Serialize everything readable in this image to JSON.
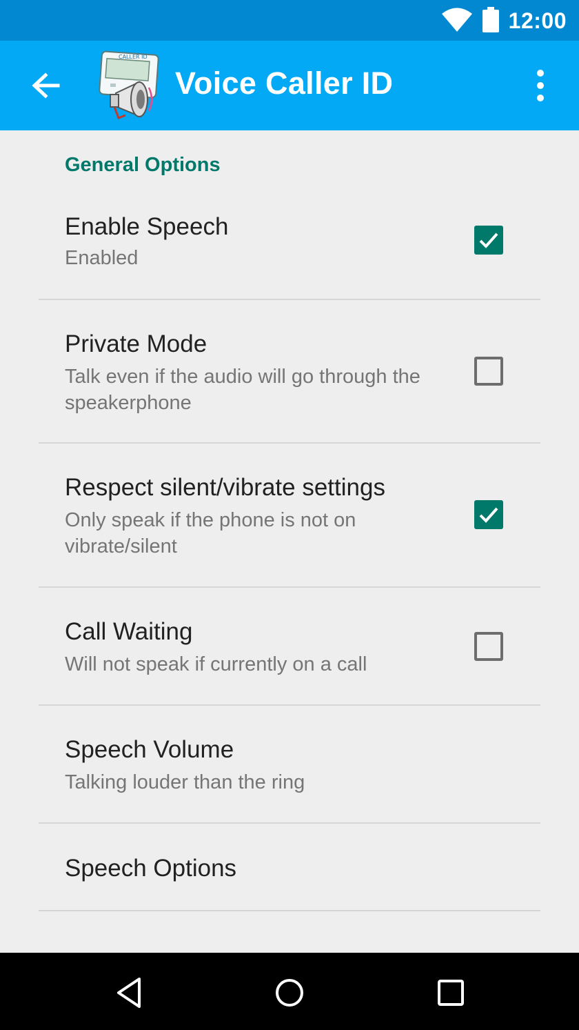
{
  "status_bar": {
    "time": "12:00",
    "icons": [
      "wifi-icon",
      "battery-icon"
    ]
  },
  "app_bar": {
    "title": "Voice Caller ID",
    "back_icon": "arrow-back-icon",
    "overflow_icon": "more-vert-icon",
    "logo": "caller-id-megaphone-logo"
  },
  "section": {
    "header": "General Options"
  },
  "prefs": [
    {
      "title": "Enable Speech",
      "summary": "Enabled",
      "checked": true
    },
    {
      "title": "Private Mode",
      "summary": "Talk even if the audio will go through the speakerphone",
      "checked": false
    },
    {
      "title": "Respect silent/vibrate settings",
      "summary": "Only speak if the phone is not on vibrate/silent",
      "checked": true
    },
    {
      "title": "Call Waiting",
      "summary": "Will not speak if currently on a call",
      "checked": false
    },
    {
      "title": "Speech Volume",
      "summary": "Talking louder than the ring"
    },
    {
      "title": "Speech Options"
    }
  ],
  "nav_bar": {
    "icons": [
      "back-triangle-icon",
      "home-circle-icon",
      "recents-square-icon"
    ]
  },
  "colors": {
    "status_bar": "#0288d1",
    "app_bar": "#03a9f4",
    "accent": "#00796b",
    "background": "#eeeeee"
  }
}
